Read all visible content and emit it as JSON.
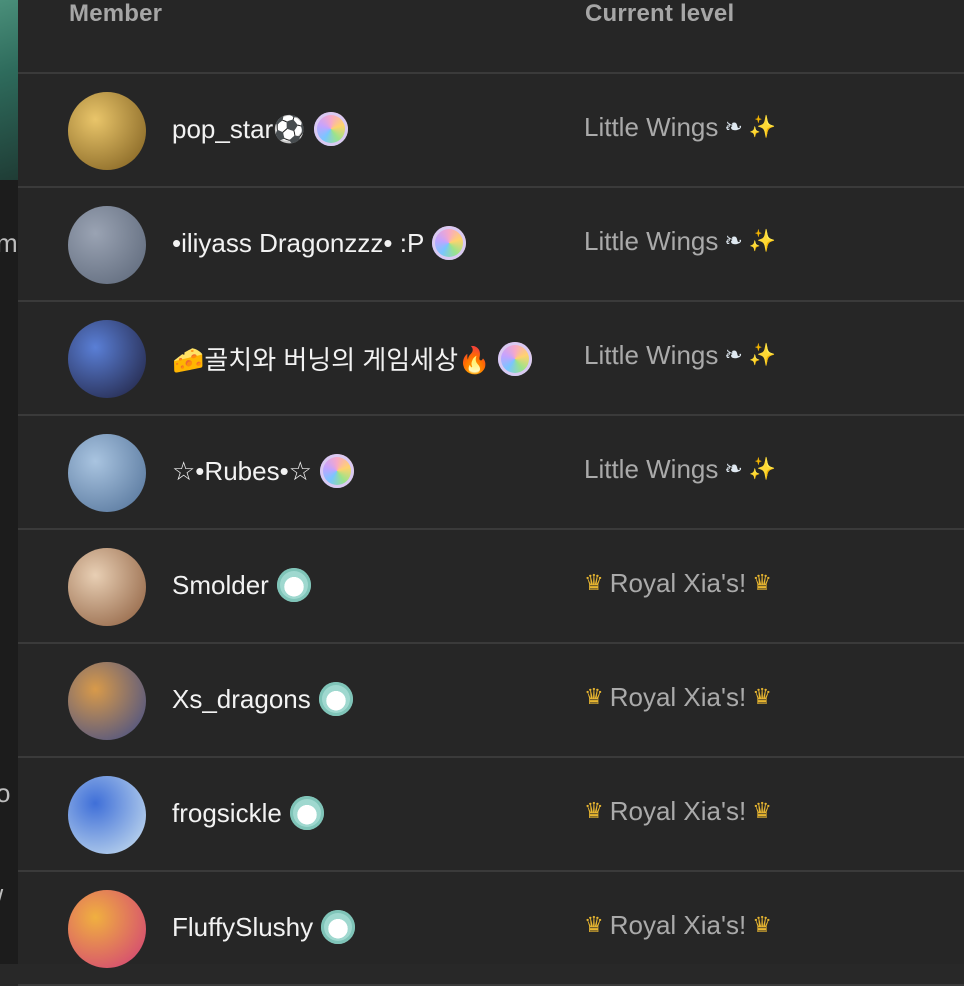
{
  "header": {
    "member_label": "Member",
    "level_label": "Current level"
  },
  "left_strip": {
    "fragments": [
      "m",
      "o",
      "/"
    ]
  },
  "members": [
    {
      "name": "pop_star⚽",
      "badge": "rainbow-badge-icon",
      "level": "Little Wings",
      "level_icons": [
        "feather-icon",
        "sparkles-icon"
      ],
      "avatar_colors": [
        "#e9c56a",
        "#7a5a1c"
      ]
    },
    {
      "name": "•iliyass Dragonzzz• :P",
      "badge": "rainbow-badge-icon",
      "level": "Little Wings",
      "level_icons": [
        "feather-icon",
        "sparkles-icon"
      ],
      "avatar_colors": [
        "#9aa3b3",
        "#5a6577"
      ]
    },
    {
      "name": "🧀골치와 버닝의 게임세상🔥",
      "badge": "rainbow-badge-icon",
      "level": "Little Wings",
      "level_icons": [
        "feather-icon",
        "sparkles-icon"
      ],
      "avatar_colors": [
        "#5a7fd6",
        "#1e1e3a"
      ]
    },
    {
      "name": "☆•Rubes•☆",
      "badge": "rainbow-badge-icon",
      "level": "Little Wings",
      "level_icons": [
        "feather-icon",
        "sparkles-icon"
      ],
      "avatar_colors": [
        "#a9c4e0",
        "#4f6f96"
      ]
    },
    {
      "name": "Smolder",
      "badge": "dog-badge-icon",
      "level": "Royal Xia's!",
      "level_icons": [
        "crown-icon",
        "crown-icon"
      ],
      "avatar_colors": [
        "#e8cfb4",
        "#8a5a3a"
      ]
    },
    {
      "name": "Xs_dragons",
      "badge": "dog-badge-icon",
      "level": "Royal Xia's!",
      "level_icons": [
        "crown-icon",
        "crown-icon"
      ],
      "avatar_colors": [
        "#d89a4a",
        "#3b4a8a"
      ]
    },
    {
      "name": "frogsickle",
      "badge": "dog-badge-icon",
      "level": "Royal Xia's!",
      "level_icons": [
        "crown-icon",
        "crown-icon"
      ],
      "avatar_colors": [
        "#3f6fd8",
        "#cfe4f0"
      ]
    },
    {
      "name": "FluffySlushy",
      "badge": "dog-badge-icon",
      "level": "Royal Xia's!",
      "level_icons": [
        "crown-icon",
        "crown-icon"
      ],
      "avatar_colors": [
        "#f0b040",
        "#d03a7a"
      ]
    }
  ],
  "glyphs": {
    "crown": "♛",
    "feather": "❧",
    "sparkles": "✨"
  }
}
